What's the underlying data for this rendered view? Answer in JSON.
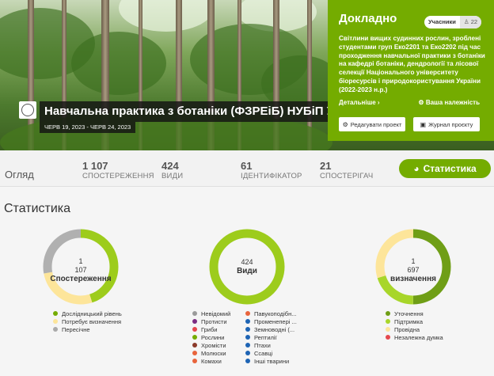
{
  "project": {
    "title": "Навчальна практика з ботаніки (ФЗРЕіБ) НУБіП У...",
    "dates": "ЧЕРВ 19, 2023 - ЧЕРВ 24, 2023"
  },
  "panel": {
    "title": "Докладно",
    "members_label": "Учасники",
    "members_count": "22",
    "description": "Світлини вищих судинних рослин, зроблені студентами груп Еко2201 та Еко2202 під час проходження навчальної практики з ботаніки на кафедрі ботаніки, дендрології та лісової селекції Національного університету біоресурсів і природокористування України (2022-2023 н.р.)",
    "more_label": "Детальніше ›",
    "affiliation_label": "Ваша належність",
    "edit_button": "Редагувати проект",
    "journal_button": "Журнал проєкту"
  },
  "overview": {
    "label": "Огляд",
    "stats": [
      {
        "value": "1 107",
        "caption": "СПОСТЕРЕЖЕННЯ"
      },
      {
        "value": "424",
        "caption": "ВИДИ"
      },
      {
        "value": "61",
        "caption": "ІДЕНТИФІКАТОР"
      },
      {
        "value": "21",
        "caption": "СПОСТЕРІГАЧ"
      }
    ],
    "stats_button": "Статистика"
  },
  "statistics": {
    "title": "Статистика",
    "donuts": [
      {
        "value_line1": "1",
        "value_line2": "107",
        "label": "Спостереження",
        "segments": [
          {
            "name": "Дослідницький рівень",
            "color": "#9dcc1c",
            "fraction": 0.45
          },
          {
            "name": "Потребує визначення",
            "color": "#fde59a",
            "fraction": 0.27
          },
          {
            "name": "Пересічне",
            "color": "#b0b0b0",
            "fraction": 0.28
          }
        ]
      },
      {
        "value_line1": "424",
        "value_line2": "",
        "label": "Види",
        "segments": [
          {
            "name": "Рослини",
            "color": "#9dcc1c",
            "fraction": 1.0
          }
        ]
      },
      {
        "value_line1": "1",
        "value_line2": "697",
        "label": "визначення",
        "segments": [
          {
            "name": "Уточнення",
            "color": "#6f9e16",
            "fraction": 0.5
          },
          {
            "name": "Підтримка",
            "color": "#a8d62a",
            "fraction": 0.2
          },
          {
            "name": "Провідна",
            "color": "#fde59a",
            "fraction": 0.3
          }
        ]
      }
    ],
    "legend_observations": [
      {
        "label": "Дослідницький рівень",
        "color": "#74ac00"
      },
      {
        "label": "Потребує визначення",
        "color": "#fde59a"
      },
      {
        "label": "Пересічне",
        "color": "#aaaaaa"
      }
    ],
    "legend_species_col1": [
      {
        "label": "Невідомий",
        "color": "#9a9a9a"
      },
      {
        "label": "Протисти",
        "color": "#7b2d82"
      },
      {
        "label": "Гриби",
        "color": "#e5484d"
      },
      {
        "label": "Рослини",
        "color": "#74ac00"
      },
      {
        "label": "Хромісти",
        "color": "#8b3a2a"
      },
      {
        "label": "Молюски",
        "color": "#e8643c"
      },
      {
        "label": "Комахи",
        "color": "#e8643c"
      }
    ],
    "legend_species_col2": [
      {
        "label": "Павукоподібн...",
        "color": "#e8643c"
      },
      {
        "label": "Променепері ...",
        "color": "#1e64b4"
      },
      {
        "label": "Земноводні (...",
        "color": "#1e64b4"
      },
      {
        "label": "Рептилії",
        "color": "#1e64b4"
      },
      {
        "label": "Птахи",
        "color": "#1e64b4"
      },
      {
        "label": "Ссавці",
        "color": "#1e64b4"
      },
      {
        "label": "Інші тварини",
        "color": "#1e64b4"
      }
    ],
    "legend_identifications": [
      {
        "label": "Уточнення",
        "color": "#6f9e16"
      },
      {
        "label": "Підтримка",
        "color": "#a8d62a"
      },
      {
        "label": "Провідна",
        "color": "#fde59a"
      },
      {
        "label": "Незалежна думка",
        "color": "#e5484d"
      }
    ]
  }
}
